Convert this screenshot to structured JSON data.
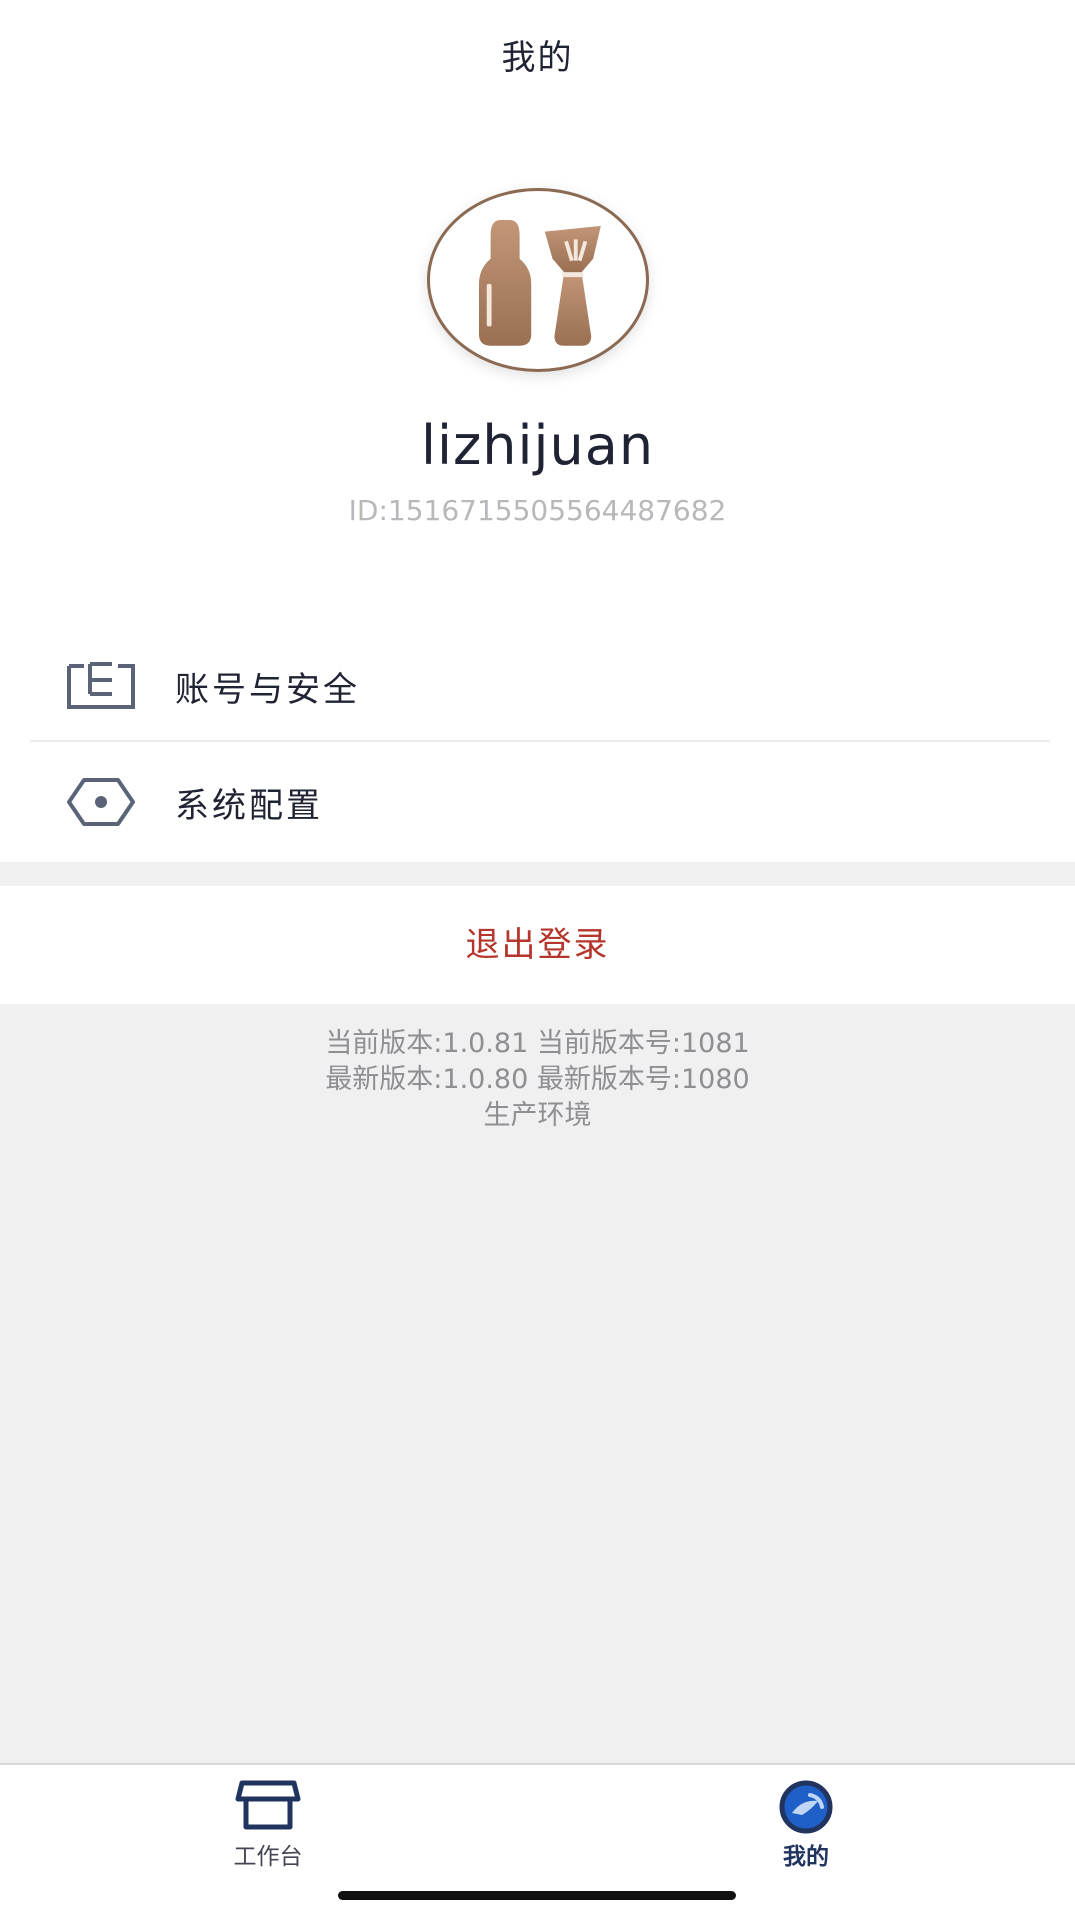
{
  "header": {
    "title": "我的"
  },
  "profile": {
    "username": "lizhijuan",
    "user_id": "ID:1516715505564487682",
    "avatar_icon": "cosmetics-logo-icon"
  },
  "menu": {
    "items": [
      {
        "label": "账号与安全",
        "icon": "id-card-icon"
      },
      {
        "label": "系统配置",
        "icon": "settings-hexagon-icon"
      }
    ]
  },
  "logout": {
    "label": "退出登录",
    "color": "#b5362c"
  },
  "version_info": {
    "line1": "当前版本:1.0.81 当前版本号:1081",
    "line2": "最新版本:1.0.80 最新版本号:1080",
    "line3": "生产环境"
  },
  "tabbar": {
    "tabs": [
      {
        "label": "工作台",
        "icon": "store-icon",
        "active": false
      },
      {
        "label": "我的",
        "icon": "profile-badge-icon",
        "active": true
      }
    ]
  },
  "colors": {
    "primary_text": "#1f2333",
    "icon_gray": "#5a6378",
    "accent_navy": "#20345f",
    "avatar_brown": "#a37b5e"
  }
}
